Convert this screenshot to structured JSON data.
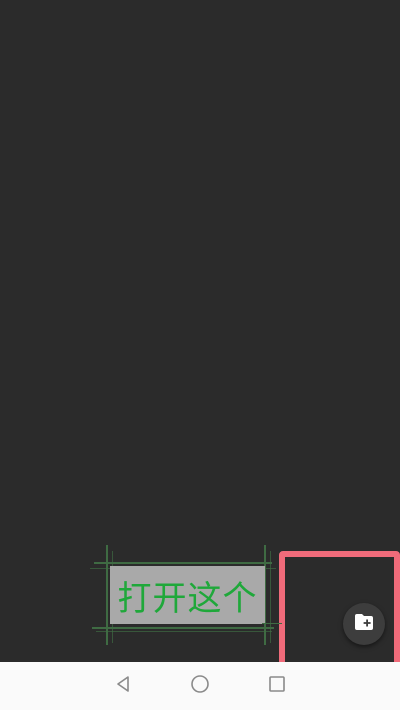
{
  "annotation": {
    "label": "打开这个"
  },
  "fab": {
    "icon": "create-folder-icon"
  },
  "navbar": {
    "back_icon": "back-triangle-icon",
    "home_icon": "home-circle-icon",
    "recents_icon": "recents-square-icon"
  },
  "colors": {
    "background": "#2b2b2b",
    "highlight": "#f06b7a",
    "label_text": "#1fa83a",
    "label_bg": "#a9a9a9",
    "navbar_bg": "#fafafa"
  }
}
